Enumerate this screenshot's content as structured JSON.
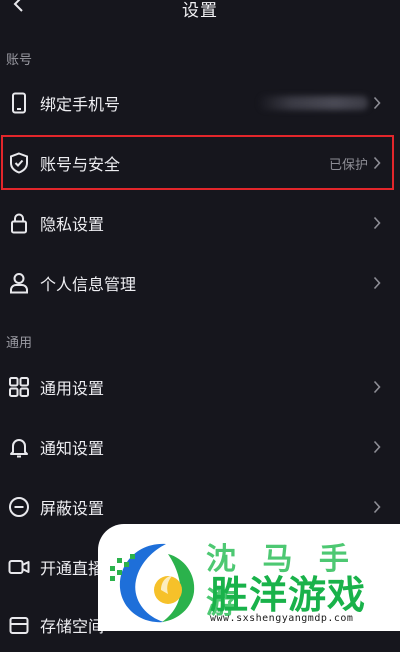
{
  "header": {
    "title": "设置"
  },
  "sections": [
    {
      "label": "账号",
      "items": [
        {
          "label": "绑定手机号",
          "value": "",
          "icon": "phone-icon",
          "value_redacted": true
        },
        {
          "label": "账号与安全",
          "value": "已保护",
          "icon": "shield-check-icon",
          "highlighted": true
        },
        {
          "label": "隐私设置",
          "value": "",
          "icon": "lock-icon"
        },
        {
          "label": "个人信息管理",
          "value": "",
          "icon": "person-icon"
        }
      ]
    },
    {
      "label": "通用",
      "items": [
        {
          "label": "通用设置",
          "value": "",
          "icon": "grid-icon"
        },
        {
          "label": "通知设置",
          "value": "",
          "icon": "bell-icon"
        },
        {
          "label": "屏蔽设置",
          "value": "",
          "icon": "minus-circle-icon"
        },
        {
          "label": "开通直播",
          "value": "",
          "icon": "video-camera-icon"
        },
        {
          "label": "存储空间",
          "value": "",
          "icon": "storage-icon"
        }
      ]
    }
  ],
  "watermark": {
    "top_text": "沈 马 手 游",
    "name": "胜洋游戏网",
    "url": "www.sxshengyangmdp.com"
  },
  "colors": {
    "background": "#16161d",
    "highlight": "#e3262b",
    "watermark_green": "#19b24a"
  }
}
